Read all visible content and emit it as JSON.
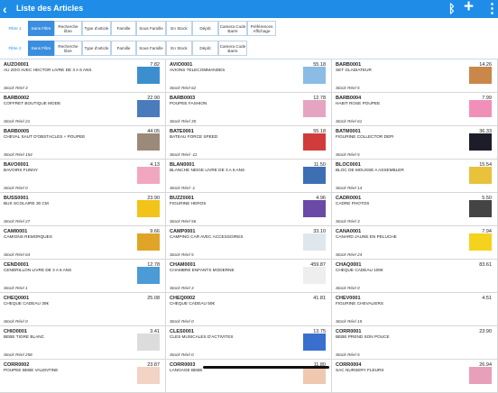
{
  "header": {
    "title": "Liste des Articles",
    "back_icon": "‹",
    "bluetooth_icon": "ᛒ",
    "add_icon": "+",
    "more_icon": "⋮"
  },
  "filters1": {
    "label": "Filtre 1",
    "buttons": [
      "Sans Filtre",
      "Recherche libre",
      "Type d'article",
      "Famille",
      "Sous Famille",
      "En Stock",
      "Dépôt",
      "Camera Code Barre",
      "Préférences Affichage"
    ]
  },
  "filters2": {
    "label": "Filtre 2",
    "buttons": [
      "Sans Filtre",
      "Recherche libre",
      "Type d'article",
      "Famille",
      "Sous Famille",
      "En Stock",
      "Dépôt",
      "Camera Code Barre"
    ]
  },
  "articles": [
    {
      "code": "AUZO0001",
      "price": "7.82",
      "name": "AU ZOO AVEC HECTOR LIVRE DE 3 A 6 ANS",
      "stock": "Stock Réel 3",
      "img": "#3b8fcf"
    },
    {
      "code": "AVIO0001",
      "price": "55.18",
      "name": "AVIONS TELECOMMANDES",
      "stock": "Stock Réel 62",
      "img": "#8bbce6"
    },
    {
      "code": "BARB0001",
      "price": "14.26",
      "name": "SET GLADIATEUR",
      "stock": "Stock Réel 5",
      "img": "#c9874a"
    },
    {
      "code": "BARB0002",
      "price": "22.90",
      "name": "COFFRET BOUTIQUE MODE",
      "stock": "Stock Réel 21",
      "img": "#4a7bbd"
    },
    {
      "code": "BARB0003",
      "price": "12.78",
      "name": "POUPEE FASHION",
      "stock": "Stock Réel 35",
      "img": "#e6a4c3"
    },
    {
      "code": "BARB0004",
      "price": "7.99",
      "name": "HABIT ROSE POUPEE",
      "stock": "Stock Réel 61",
      "img": "#f08fb8"
    },
    {
      "code": "BARB0005",
      "price": "44.05",
      "name": "CHEVAL SAUT D'OBSTACLES + POUPEE",
      "stock": "Stock Réel 154",
      "img": "#9b8a7a"
    },
    {
      "code": "BATE0001",
      "price": "55.18",
      "name": "BATEAU FORCE SPEED",
      "stock": "Stock Réel -11",
      "img": "#d23b3b"
    },
    {
      "code": "BATM0001",
      "price": "36.33",
      "name": "FIGURINE COLLECTOR DEPI",
      "stock": "Stock Réel 5",
      "img": "#1d1d2a"
    },
    {
      "code": "BAVO0001",
      "price": "4.13",
      "name": "BAVOIRS FUNNY",
      "stock": "Stock Réel 0",
      "img": "#f2a7c0"
    },
    {
      "code": "BLAN0001",
      "price": "11.50",
      "name": "BLANCHE NEIGE LIVRE DE 3 A 6 ANS",
      "stock": "Stock Réel -1",
      "img": "#3e6fb5"
    },
    {
      "code": "BLOC0001",
      "price": "15.54",
      "name": "BLOC DE MOUSSE A ASSEMBLER",
      "stock": "Stock Réel 14",
      "img": "#e8c23a"
    },
    {
      "code": "BUSS0001",
      "price": "23.90",
      "name": "BUS SCOLAIRE 30 CM",
      "stock": "Stock Réel 27",
      "img": "#f2c318"
    },
    {
      "code": "BUZZ0001",
      "price": "4.96",
      "name": "FIGURINE HEROS",
      "stock": "Stock Réel 56",
      "img": "#6a4aa6"
    },
    {
      "code": "CADR0001",
      "price": "5.50",
      "name": "CADRE PHOTOS",
      "stock": "Stock Réel 3",
      "img": "#444444"
    },
    {
      "code": "CAMI0001",
      "price": "9.66",
      "name": "CAMIONS REMORQUES",
      "stock": "Stock Réel 64",
      "img": "#e0a526"
    },
    {
      "code": "CAMP0001",
      "price": "33.10",
      "name": "CAMPING CAR AVEC ACCESSOIRES",
      "stock": "Stock Réel 5",
      "img": "#dfe6ec"
    },
    {
      "code": "CANA0001",
      "price": "7.94",
      "name": "CANARD JAUNE EN PELUCHE",
      "stock": "Stock Réel 24",
      "img": "#f5d21c"
    },
    {
      "code": "CEND0001",
      "price": "12.78",
      "name": "CENDRILLON LIVRE DE 3 A 6 ANS",
      "stock": "Stock Réel 1",
      "img": "#4b9bd6"
    },
    {
      "code": "CHAM0001",
      "price": "459.87",
      "name": "CHAMBRE ENFANTS MODERNE",
      "stock": "Stock Réel 3",
      "img": "#eeeeee"
    },
    {
      "code": "CHAQ0001",
      "price": "83.61",
      "name": "CHEQUE CADEAU 100€",
      "stock": "Stock Réel 0",
      "img": "#ffffff"
    },
    {
      "code": "CHEQ0001",
      "price": "25.08",
      "name": "CHEQUE CADEAU 30€",
      "stock": "Stock Réel 0",
      "img": "#ffffff"
    },
    {
      "code": "CHEQ0002",
      "price": "41.81",
      "name": "CHEQUE CADEAU 50€",
      "stock": "Stock Réel 0",
      "img": "#ffffff"
    },
    {
      "code": "CHEV0001",
      "price": "4.51",
      "name": "FIGURINE CHEVALIERS",
      "stock": "Stock Réel 15",
      "img": "#ffffff"
    },
    {
      "code": "CHIO0001",
      "price": "3.41",
      "name": "BEBE TIGRE BLANC",
      "stock": "Stock Réel 258",
      "img": "#dcdcdc"
    },
    {
      "code": "CLES0001",
      "price": "13.75",
      "name": "CLES MUSICALES D'ACTIVITES",
      "stock": "Stock Réel 0",
      "img": "#3a6fd0"
    },
    {
      "code": "CORR0001",
      "price": "23.90",
      "name": "BEBE PREND SON POUCE",
      "stock": "Stock Réel 5",
      "img": "#ffffff"
    },
    {
      "code": "CORR0002",
      "price": "23.87",
      "name": "POUPEE BEBE VALENTINE",
      "stock": "",
      "img": "#f3d3c4"
    },
    {
      "code": "CORR0003",
      "price": "11.80",
      "name": "LANGAGE BEBE",
      "stock": "",
      "img": "#f0c8b0"
    },
    {
      "code": "CORR0004",
      "price": "26.94",
      "name": "SAC NURSERY FLEURS",
      "stock": "",
      "img": "#e89fb9"
    }
  ]
}
